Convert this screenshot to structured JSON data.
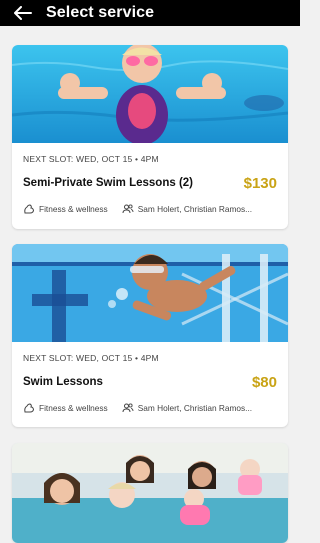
{
  "header": {
    "title": "Select service",
    "back_icon": "arrow-left-icon"
  },
  "services": [
    {
      "slot": "NEXT SLOT: WED, OCT 15 • 4PM",
      "name": "Semi-Private Swim Lessons (2)",
      "price": "$130",
      "category": "Fitness & wellness",
      "staff": "Sam Holert, Christian Ramos..."
    },
    {
      "slot": "NEXT SLOT: WED, OCT 15 • 4PM",
      "name": "Swim Lessons",
      "price": "$80",
      "category": "Fitness & wellness",
      "staff": "Sam Holert, Christian Ramos..."
    }
  ],
  "colors": {
    "header_bg": "#000000",
    "price": "#c9a315",
    "background": "#f1f1f1"
  },
  "icons": {
    "category": "dumbbell-arm-icon",
    "staff": "people-icon"
  }
}
